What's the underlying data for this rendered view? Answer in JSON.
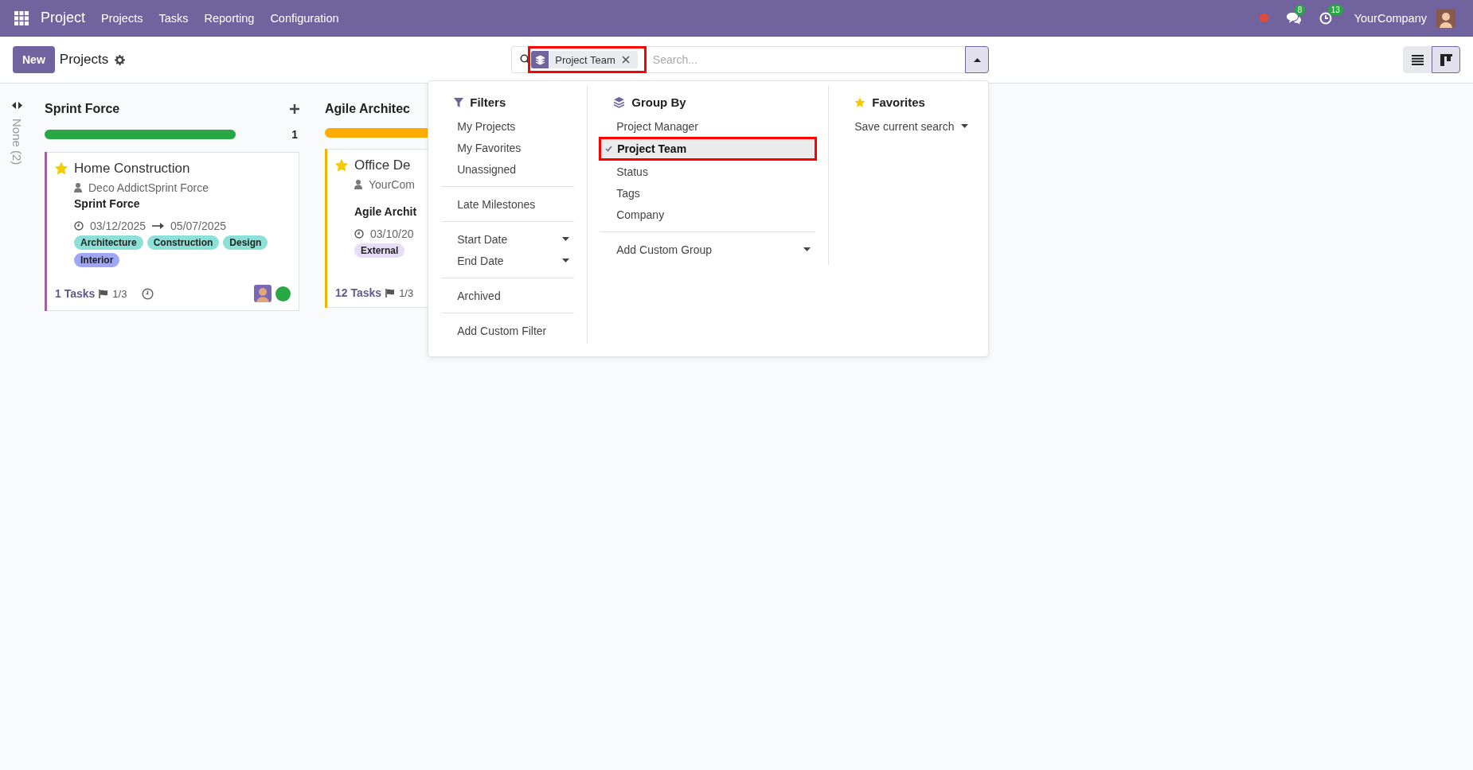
{
  "navbar": {
    "app_name": "Project",
    "menu": [
      "Projects",
      "Tasks",
      "Reporting",
      "Configuration"
    ],
    "chat_count": "8",
    "activity_count": "13",
    "company": "YourCompany"
  },
  "control_panel": {
    "new_button": "New",
    "title": "Projects",
    "search": {
      "facet": "Project Team",
      "placeholder": "Search..."
    },
    "views": [
      {
        "kind": "list",
        "selected": false
      },
      {
        "kind": "kanban",
        "selected": true
      }
    ]
  },
  "search_panel": {
    "filters": {
      "title": "Filters",
      "groups": [
        [
          "My Projects",
          "My Favorites",
          "Unassigned"
        ],
        [
          "Late Milestones"
        ],
        [
          {
            "label": "Start Date",
            "kind": "submenu"
          },
          {
            "label": "End Date",
            "kind": "submenu"
          }
        ],
        [
          "Archived"
        ],
        [
          "Add Custom Filter"
        ]
      ]
    },
    "group_by": {
      "title": "Group By",
      "items": [
        {
          "label": "Project Manager",
          "selected": false
        },
        {
          "label": "Project Team",
          "selected": true
        },
        {
          "label": "Status",
          "selected": false
        },
        {
          "label": "Tags",
          "selected": false
        },
        {
          "label": "Company",
          "selected": false
        }
      ],
      "custom": "Add Custom Group"
    },
    "favorites": {
      "title": "Favorites",
      "save": "Save current search"
    }
  },
  "folded_column": "None (2)",
  "columns": [
    {
      "title": "Sprint Force",
      "count": "1",
      "progress": {
        "color": "#28a745",
        "level": 1
      },
      "cards": [
        {
          "color": "#a0609e",
          "favorite": true,
          "title": "Home Construction",
          "partner": "Deco AddictSprint Force",
          "team": "Sprint Force",
          "start": "03/12/2025",
          "end": "05/07/2025",
          "tags": [
            {
              "label": "Architecture",
              "color": "#8be0d8"
            },
            {
              "label": "Construction",
              "color": "#8be0d8"
            },
            {
              "label": "Design",
              "color": "#8be0d8"
            },
            {
              "label": "Interior",
              "color": "#9ea6f5"
            }
          ],
          "tasks": "1 Tasks",
          "milestones": "1/3",
          "status": {
            "color": "#28a745"
          }
        }
      ]
    },
    {
      "title": "Agile Architec",
      "progress": {
        "color": "#ffac00",
        "level": 1
      },
      "cards": [
        {
          "color": "#f0b400",
          "favorite": true,
          "title": "Office De",
          "partner": "YourCom",
          "team": "Agile Archit",
          "start": "03/10/20",
          "tags": [
            {
              "label": "External",
              "color": "#e6dcf7"
            }
          ],
          "tasks": "12 Tasks",
          "milestones": "1/3"
        }
      ]
    }
  ]
}
